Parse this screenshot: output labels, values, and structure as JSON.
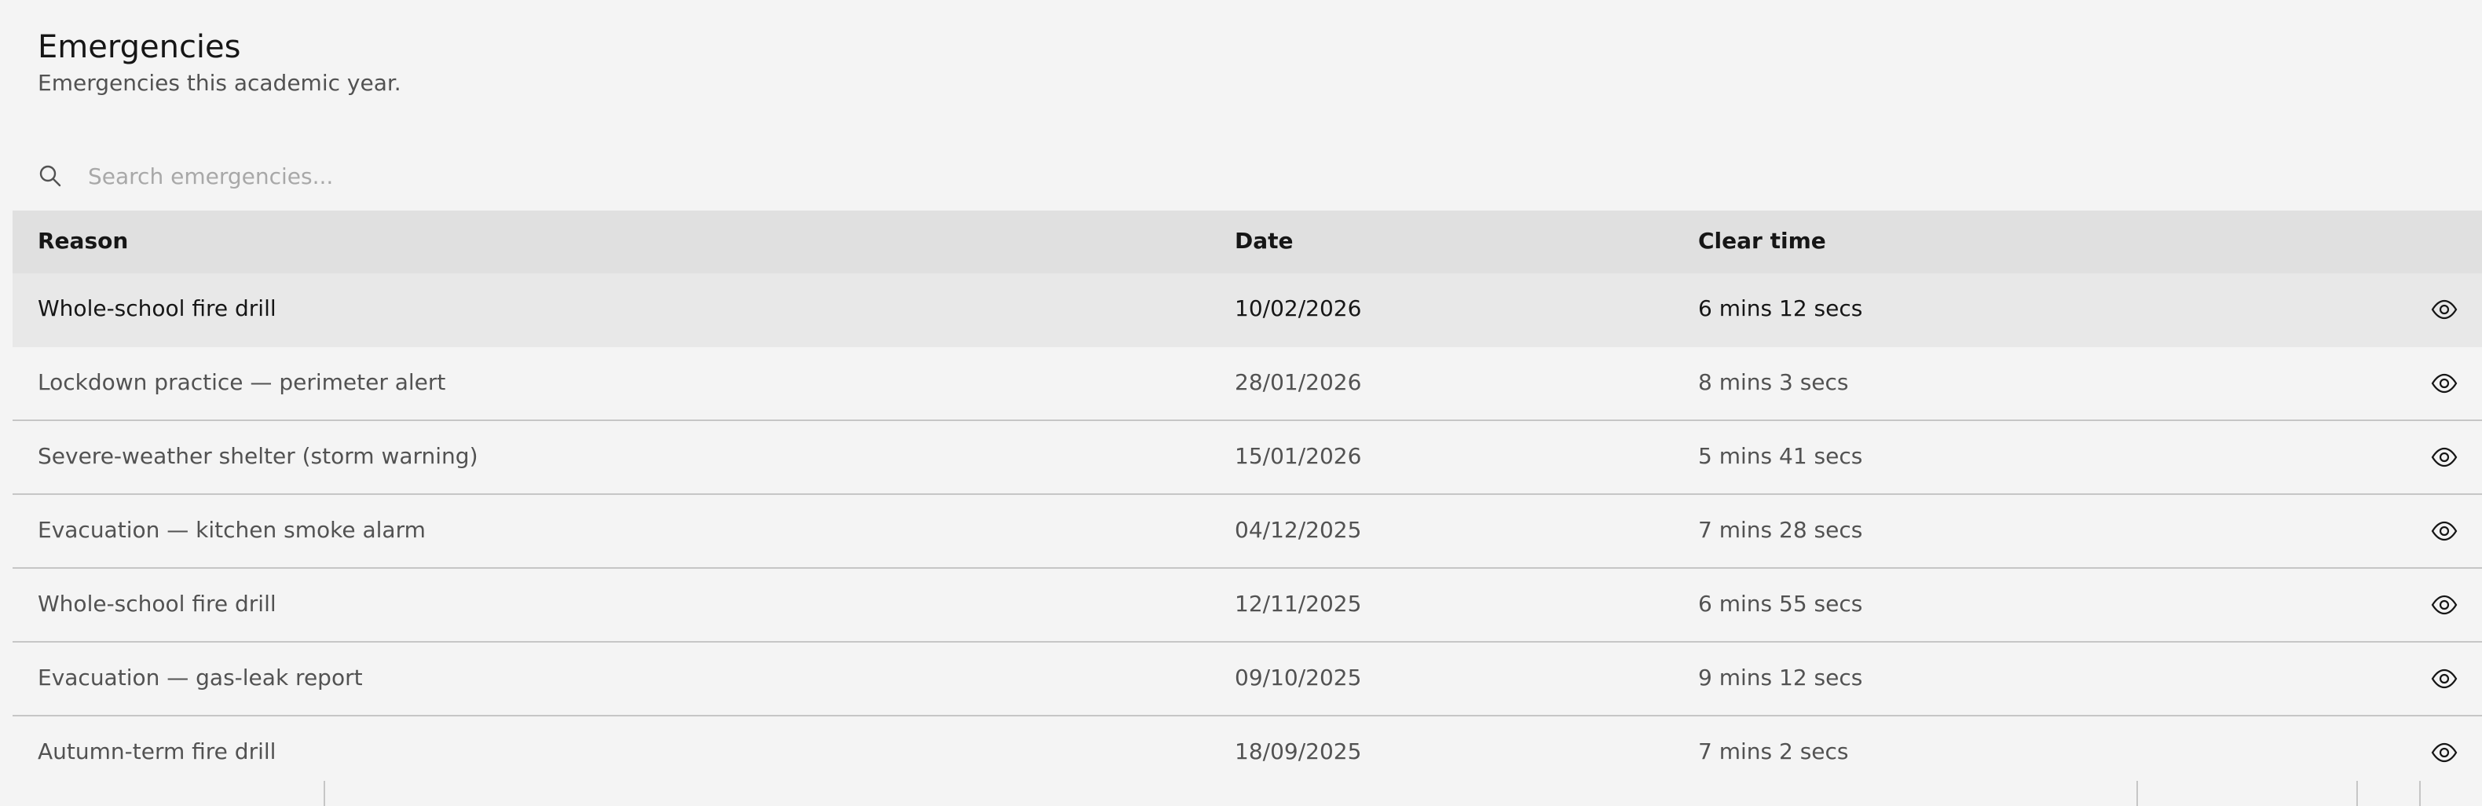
{
  "header": {
    "title": "Emergencies",
    "subtitle": "Emergencies this academic year."
  },
  "search": {
    "placeholder": "Search emergencies..."
  },
  "table": {
    "columns": {
      "reason": "Reason",
      "date": "Date",
      "clear_time": "Clear time"
    },
    "rows": [
      {
        "reason": "Whole-school fire drill",
        "date": "10/02/2026",
        "clear_time": "6 mins 12 secs"
      },
      {
        "reason": "Lockdown practice — perimeter alert",
        "date": "28/01/2026",
        "clear_time": "8 mins 3 secs"
      },
      {
        "reason": "Severe-weather shelter (storm warning)",
        "date": "15/01/2026",
        "clear_time": "5 mins 41 secs"
      },
      {
        "reason": "Evacuation — kitchen smoke alarm",
        "date": "04/12/2025",
        "clear_time": "7 mins 28 secs"
      },
      {
        "reason": "Whole-school fire drill",
        "date": "12/11/2025",
        "clear_time": "6 mins 55 secs"
      },
      {
        "reason": "Evacuation — gas-leak report",
        "date": "09/10/2025",
        "clear_time": "9 mins 12 secs"
      },
      {
        "reason": "Autumn-term fire drill",
        "date": "18/09/2025",
        "clear_time": "7 mins 2 secs"
      }
    ],
    "row_icon": "eye-icon",
    "highlighted_row": 0
  },
  "colors": {
    "background": "#f4f4f4",
    "header_bg": "#e0e0e0",
    "row_hover": "#e8e8e8",
    "border": "#c6c6c6",
    "text_primary": "#161616",
    "text_secondary": "#525252",
    "placeholder": "#a8a8a8"
  }
}
